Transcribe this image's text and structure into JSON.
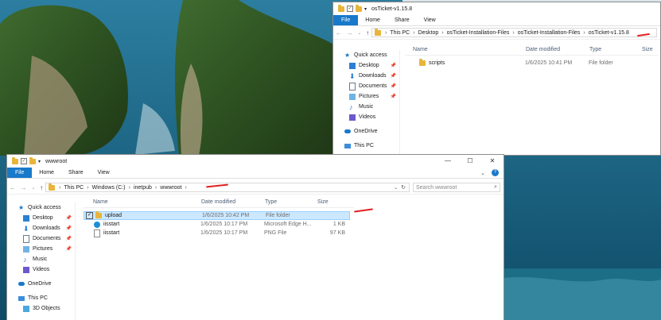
{
  "windows": [
    {
      "id": "top",
      "title": "osTicket-v1.15.8",
      "ribbon_tabs": [
        "File",
        "Home",
        "Share",
        "View"
      ],
      "breadcrumb": [
        "This PC",
        "Desktop",
        "osTicket-Installation-Files",
        "osTicket-Installation-Files",
        "osTicket-v1.15.8"
      ],
      "nav_pane": [
        {
          "label": "Quick access",
          "icon": "star-icon",
          "pinned": false,
          "sub": false
        },
        {
          "label": "Desktop",
          "icon": "desktop-icon",
          "pinned": true,
          "sub": true
        },
        {
          "label": "Downloads",
          "icon": "download-icon",
          "pinned": true,
          "sub": true
        },
        {
          "label": "Documents",
          "icon": "documents-icon",
          "pinned": true,
          "sub": true
        },
        {
          "label": "Pictures",
          "icon": "pictures-icon",
          "pinned": true,
          "sub": true
        },
        {
          "label": "Music",
          "icon": "music-icon",
          "pinned": false,
          "sub": true
        },
        {
          "label": "Videos",
          "icon": "videos-icon",
          "pinned": false,
          "sub": true
        },
        {
          "label": "OneDrive",
          "icon": "cloud-icon",
          "pinned": false,
          "sub": false
        },
        {
          "label": "This PC",
          "icon": "pc-icon",
          "pinned": false,
          "sub": false
        }
      ],
      "columns": [
        "Name",
        "Date modified",
        "Type",
        "Size"
      ],
      "rows": [
        {
          "name": "scripts",
          "date": "1/6/2025 10:41 PM",
          "type": "File folder",
          "size": "",
          "icon": "folder-icon",
          "selected": false
        }
      ]
    },
    {
      "id": "bottom",
      "title": "wwwroot",
      "ribbon_tabs": [
        "File",
        "Home",
        "Share",
        "View"
      ],
      "breadcrumb": [
        "This PC",
        "Windows (C:)",
        "inetpub",
        "wwwroot"
      ],
      "search_placeholder": "Search wwwroot",
      "nav_pane": [
        {
          "label": "Quick access",
          "icon": "star-icon",
          "pinned": false,
          "sub": false
        },
        {
          "label": "Desktop",
          "icon": "desktop-icon",
          "pinned": true,
          "sub": true
        },
        {
          "label": "Downloads",
          "icon": "download-icon",
          "pinned": true,
          "sub": true
        },
        {
          "label": "Documents",
          "icon": "documents-icon",
          "pinned": true,
          "sub": true
        },
        {
          "label": "Pictures",
          "icon": "pictures-icon",
          "pinned": true,
          "sub": true
        },
        {
          "label": "Music",
          "icon": "music-icon",
          "pinned": false,
          "sub": true
        },
        {
          "label": "Videos",
          "icon": "videos-icon",
          "pinned": false,
          "sub": true
        },
        {
          "label": "OneDrive",
          "icon": "cloud-icon",
          "pinned": false,
          "sub": false
        },
        {
          "label": "This PC",
          "icon": "pc-icon",
          "pinned": false,
          "sub": false
        },
        {
          "label": "3D Objects",
          "icon": "3d-objects-icon",
          "pinned": false,
          "sub": true
        }
      ],
      "columns": [
        "Name",
        "Date modified",
        "Type",
        "Size"
      ],
      "rows": [
        {
          "name": "upload",
          "date": "1/6/2025 10:42 PM",
          "type": "File folder",
          "size": "",
          "icon": "folder-icon",
          "selected": true
        },
        {
          "name": "iisstart",
          "date": "1/6/2025 10:17 PM",
          "type": "Microsoft Edge H...",
          "size": "1 KB",
          "icon": "edge-icon",
          "selected": false
        },
        {
          "name": "iisstart",
          "date": "1/6/2025 10:17 PM",
          "type": "PNG File",
          "size": "97 KB",
          "icon": "image-file-icon",
          "selected": false
        }
      ]
    }
  ],
  "colors": {
    "accent": "#1979ca",
    "annotation": "#e02020",
    "folder": "#e8b53a"
  }
}
